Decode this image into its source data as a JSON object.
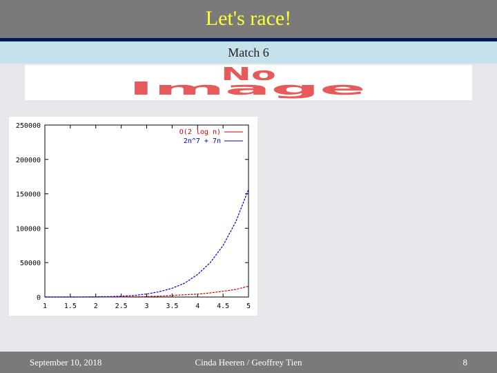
{
  "slide": {
    "title": "Let's race!",
    "subtitle": "Match 6",
    "placeholder_line1": "No",
    "placeholder_line2": "Image"
  },
  "chart_data": {
    "type": "line",
    "x": [
      1,
      1.25,
      1.5,
      1.75,
      2,
      2.25,
      2.5,
      2.75,
      3,
      3.25,
      3.5,
      3.75,
      4,
      4.25,
      4.5,
      4.75,
      5
    ],
    "series": [
      {
        "name": "O(2 log n)",
        "color": "#cc0000",
        "values": [
          3,
          9,
          16,
          30,
          48,
          86,
          171,
          368,
          729,
          1322,
          2197,
          3398,
          4096,
          6000,
          8305,
          11000,
          15625
        ]
      },
      {
        "name": "2n^7 + 7n",
        "color": "#0000cc",
        "values": [
          9,
          18,
          45,
          124,
          270,
          612,
          1238,
          2329,
          4395,
          7690,
          12780,
          20290,
          32796,
          50080,
          74765,
          109400,
          156285
        ]
      }
    ],
    "xticks": [
      "1",
      "1.5",
      "2",
      "2.5",
      "3",
      "3.5",
      "4",
      "4.5",
      "5"
    ],
    "yticks": [
      "0",
      "50000",
      "100000",
      "150000",
      "200000",
      "250000"
    ],
    "xlim": [
      1,
      5
    ],
    "ylim": [
      0,
      250000
    ],
    "legend_position": "top-right",
    "grid": false
  },
  "footer": {
    "date": "September 10, 2018",
    "author": "Cinda Heeren / Geoffrey Tien",
    "page": "8"
  }
}
